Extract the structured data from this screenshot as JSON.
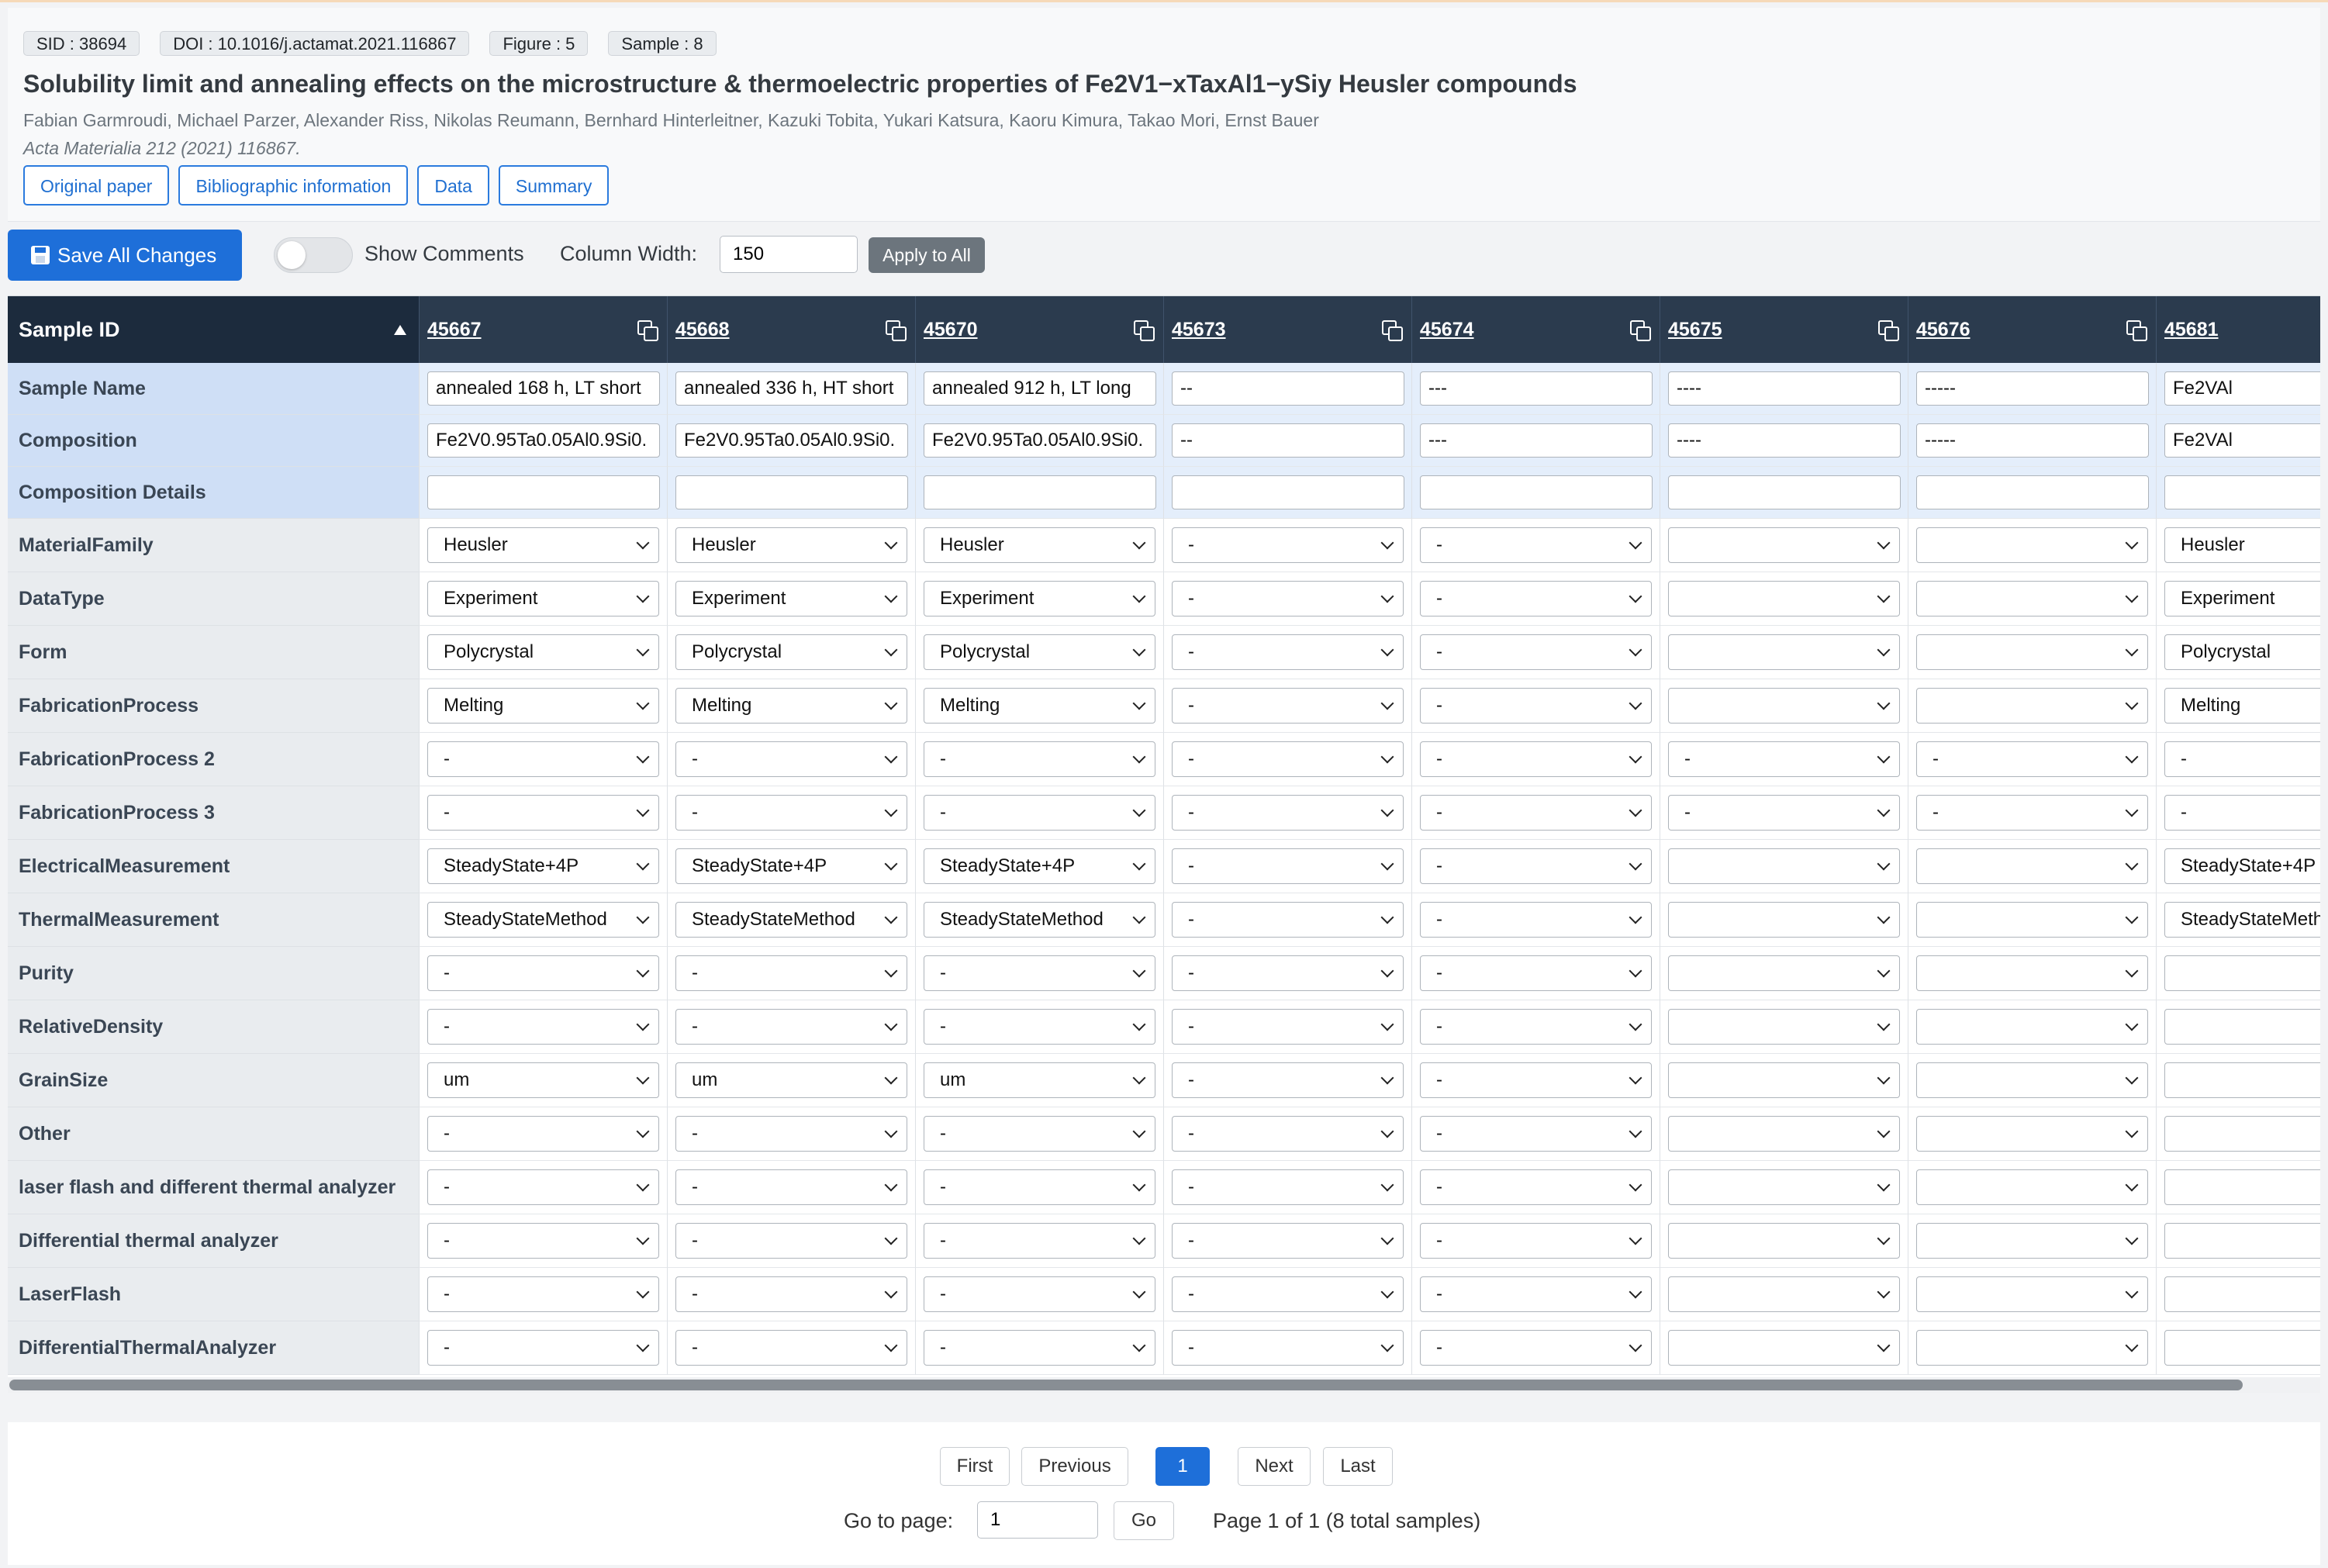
{
  "header": {
    "badges": [
      "SID : 38694",
      "DOI : 10.1016/j.actamat.2021.116867",
      "Figure : 5",
      "Sample : 8"
    ],
    "title": "Solubility limit and annealing effects on the microstructure & thermoelectric properties of Fe2V1−xTaxAl1−ySiy Heusler compounds",
    "authors": "Fabian Garmroudi, Michael Parzer, Alexander Riss, Nikolas Reumann, Bernhard Hinterleitner, Kazuki Tobita, Yukari Katsura, Kaoru Kimura, Takao Mori, Ernst Bauer",
    "journal": "Acta Materialia 212  (2021)  116867.",
    "links": [
      "Original paper",
      "Bibliographic information",
      "Data",
      "Summary"
    ]
  },
  "toolbar": {
    "save_label": "Save All Changes",
    "show_comments_label": "Show Comments",
    "show_comments_on": false,
    "column_width_label": "Column Width:",
    "column_width_value": "150",
    "apply_label": "Apply to All"
  },
  "table": {
    "id_header": "Sample ID",
    "sample_ids": [
      "45667",
      "45668",
      "45670",
      "45673",
      "45674",
      "45675",
      "45676",
      "45681"
    ],
    "rows": [
      {
        "label": "Sample Name",
        "type": "text",
        "highlight": true,
        "values": [
          "annealed 168 h, LT short",
          "annealed 336 h, HT short",
          "annealed 912 h, LT long",
          "--",
          "---",
          "----",
          "-----",
          "Fe2VAl"
        ]
      },
      {
        "label": "Composition",
        "type": "text",
        "highlight": true,
        "values": [
          "Fe2V0.95Ta0.05Al0.9Si0.",
          "Fe2V0.95Ta0.05Al0.9Si0.",
          "Fe2V0.95Ta0.05Al0.9Si0.",
          "--",
          "---",
          "----",
          "-----",
          "Fe2VAl"
        ]
      },
      {
        "label": "Composition Details",
        "type": "text",
        "highlight": true,
        "values": [
          "",
          "",
          "",
          "",
          "",
          "",
          "",
          ""
        ]
      },
      {
        "label": "MaterialFamily",
        "type": "select",
        "values": [
          "Heusler",
          "Heusler",
          "Heusler",
          "-",
          "-",
          "",
          "",
          "Heusler"
        ]
      },
      {
        "label": "DataType",
        "type": "select",
        "values": [
          "Experiment",
          "Experiment",
          "Experiment",
          "-",
          "-",
          "",
          "",
          "Experiment"
        ]
      },
      {
        "label": "Form",
        "type": "select",
        "values": [
          "Polycrystal",
          "Polycrystal",
          "Polycrystal",
          "-",
          "-",
          "",
          "",
          "Polycrystal"
        ]
      },
      {
        "label": "FabricationProcess",
        "type": "select",
        "values": [
          "Melting",
          "Melting",
          "Melting",
          "-",
          "-",
          "",
          "",
          "Melting"
        ]
      },
      {
        "label": "FabricationProcess 2",
        "type": "select",
        "values": [
          "-",
          "-",
          "-",
          "-",
          "-",
          "-",
          "-",
          "-"
        ]
      },
      {
        "label": "FabricationProcess 3",
        "type": "select",
        "values": [
          "-",
          "-",
          "-",
          "-",
          "-",
          "-",
          "-",
          "-"
        ]
      },
      {
        "label": "ElectricalMeasurement",
        "type": "select",
        "values": [
          "SteadyState+4P",
          "SteadyState+4P",
          "SteadyState+4P",
          "-",
          "-",
          "",
          "",
          "SteadyState+4P"
        ]
      },
      {
        "label": "ThermalMeasurement",
        "type": "select",
        "values": [
          "SteadyStateMethod",
          "SteadyStateMethod",
          "SteadyStateMethod",
          "-",
          "-",
          "",
          "",
          "SteadyStateMeth"
        ]
      },
      {
        "label": "Purity",
        "type": "select",
        "values": [
          "-",
          "-",
          "-",
          "-",
          "-",
          "",
          "",
          ""
        ]
      },
      {
        "label": "RelativeDensity",
        "type": "select",
        "values": [
          "-",
          "-",
          "-",
          "-",
          "-",
          "",
          "",
          ""
        ]
      },
      {
        "label": "GrainSize",
        "type": "select",
        "values": [
          "um",
          "um",
          "um",
          "-",
          "-",
          "",
          "",
          ""
        ]
      },
      {
        "label": "Other",
        "type": "select",
        "values": [
          "-",
          "-",
          "-",
          "-",
          "-",
          "",
          "",
          ""
        ]
      },
      {
        "label": "laser flash and different thermal analyzer",
        "type": "select",
        "values": [
          "-",
          "-",
          "-",
          "-",
          "-",
          "",
          "",
          ""
        ]
      },
      {
        "label": "Differential thermal analyzer",
        "type": "select",
        "values": [
          "-",
          "-",
          "-",
          "-",
          "-",
          "",
          "",
          ""
        ]
      },
      {
        "label": "LaserFlash",
        "type": "select",
        "values": [
          "-",
          "-",
          "-",
          "-",
          "-",
          "",
          "",
          ""
        ]
      },
      {
        "label": "DifferentialThermalAnalyzer",
        "type": "select",
        "values": [
          "-",
          "-",
          "-",
          "-",
          "-",
          "",
          "",
          ""
        ]
      }
    ]
  },
  "pagination": {
    "first": "First",
    "previous": "Previous",
    "current": "1",
    "next": "Next",
    "last": "Last",
    "goto_label": "Go to page:",
    "goto_value": "1",
    "go_label": "Go",
    "info": "Page 1 of 1 (8 total samples)"
  },
  "colors": {
    "primary": "#1e6fd9",
    "header_dark": "#1c2b3d",
    "highlight_row": "#cfdff6"
  }
}
